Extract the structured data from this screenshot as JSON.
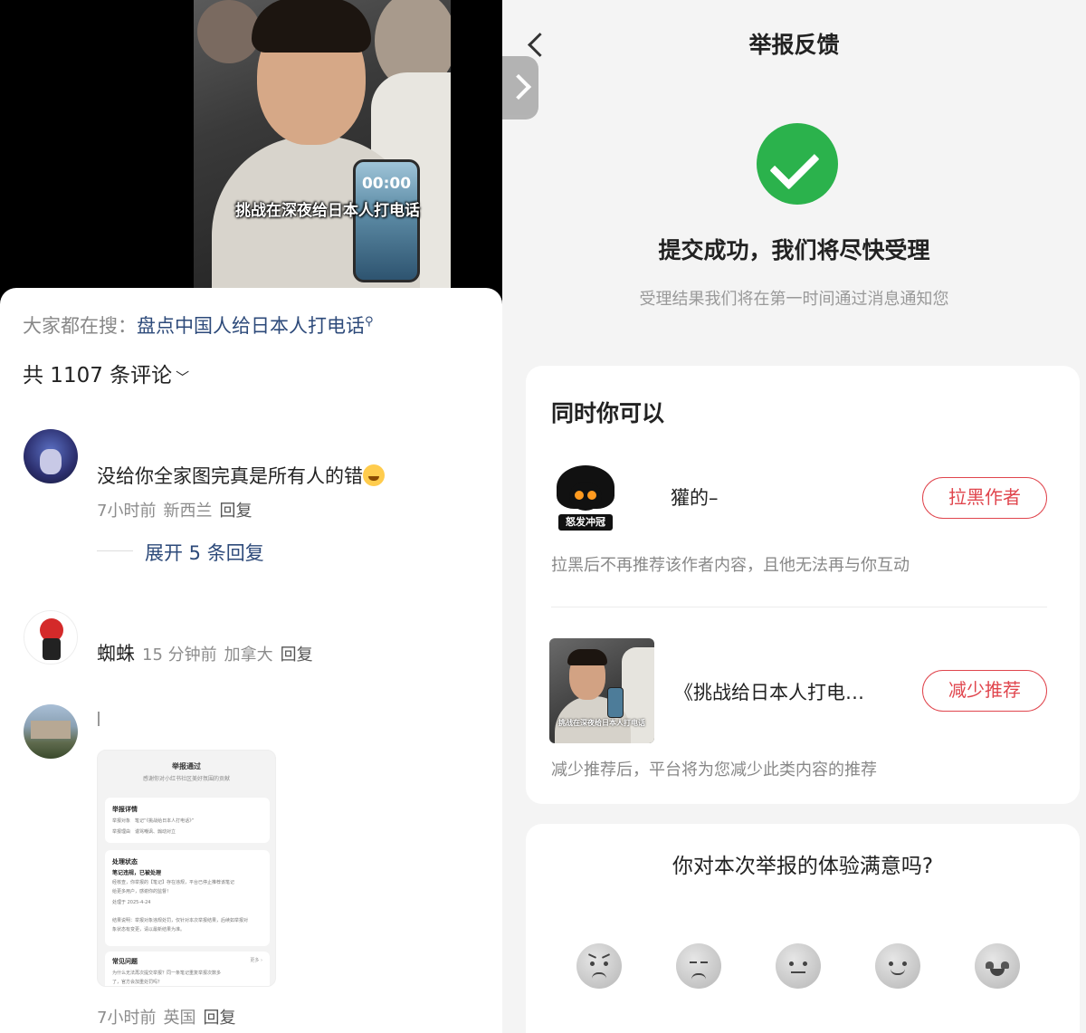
{
  "left": {
    "video": {
      "caption": "挑战在深夜给日本人打电话",
      "phone_time": "00:00"
    },
    "search": {
      "prefix": "大家都在搜：",
      "query": "盘点中国人给日本人打电话"
    },
    "comments_header": {
      "count_label": "共 1107 条评论",
      "chevron": "chevron-down-icon"
    },
    "comments": [
      {
        "text": "没给你全家图完真是所有人的错",
        "time": "7小时前",
        "location": "新西兰",
        "reply_label": "回复",
        "expand_label": "展开 5 条回复"
      },
      {
        "name": "蜘蛛",
        "time": "15 分钟前",
        "location": "加拿大",
        "reply_label": "回复"
      },
      {
        "time": "7小时前",
        "location": "英国",
        "reply_label": "回复",
        "image": {
          "title": "举报通过",
          "subtitle": "感谢你对小红书社区美好氛围的贡献",
          "detail_heading": "举报详情",
          "detail_target": "举报对象　笔记“《挑战给日本人打电话》”",
          "detail_reason": "举报理由　谩骂嘲讽、煽动对立",
          "status_heading": "处理状态",
          "status_result": "笔记违规，已被处理",
          "status_line1": "经核查，你举报的【笔记】存在违规，平台已停止推荐该笔记",
          "status_line2": "给更多用户，感谢你的监督！",
          "status_date": "处理于 2025-4-24",
          "status_note1": "结果说明：举报对象违规处罚，仅针对本次举报结果，后续如举报对",
          "status_note2": "象状态有变更，请以最新结果为准。",
          "faq_heading": "常见问题",
          "faq_more": "更多 ›",
          "faq_line1": "为什么无法再次提交举报？同一条笔记重复举报次数多",
          "faq_line2": "了，官方会加重处罚吗？"
        }
      }
    ]
  },
  "right": {
    "title": "举报反馈",
    "success_title": "提交成功，我们将尽快受理",
    "success_subtitle": "受理结果我们将在第一时间通过消息通知您",
    "actions": {
      "title": "同时你可以",
      "author": {
        "name": "獾的–",
        "avatar_text": "怒发冲冠",
        "button": "拉黑作者",
        "description": "拉黑后不再推荐该作者内容，且他无法再与你互动"
      },
      "note": {
        "title": "《挑战给日本人打电…",
        "thumb_caption": "挑战在深夜给日本人打电话",
        "button": "减少推荐",
        "description": "减少推荐后，平台将为您减少此类内容的推荐"
      }
    },
    "survey": {
      "question": "你对本次举报的体验满意吗?",
      "options": [
        "very-dissatisfied-icon",
        "dissatisfied-icon",
        "neutral-icon",
        "satisfied-icon",
        "very-satisfied-icon"
      ]
    }
  },
  "colors": {
    "accent_red": "#e0454d",
    "success_green": "#2bb24c",
    "link_blue": "#2d4a7a"
  }
}
